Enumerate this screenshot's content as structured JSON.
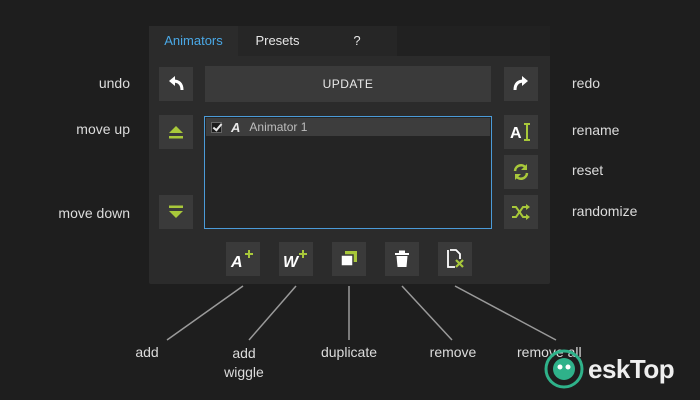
{
  "tabs": [
    {
      "label": "Animators"
    },
    {
      "label": "Presets"
    },
    {
      "label": "?"
    }
  ],
  "toolbar": {
    "update_label": "UPDATE"
  },
  "list": {
    "items": [
      {
        "checked": true,
        "icon": "A",
        "name": "Animator 1"
      }
    ]
  },
  "bottom_buttons": {
    "add_icon": "A",
    "wiggle_icon": "W"
  },
  "labels": {
    "undo": "undo",
    "move_up": "move up",
    "move_down": "move down",
    "redo": "redo",
    "rename": "rename",
    "reset": "reset",
    "randomize": "randomize",
    "add": "add",
    "add_wiggle_1": "add",
    "add_wiggle_2": "wiggle",
    "duplicate": "duplicate",
    "remove": "remove",
    "remove_all": "remove all"
  },
  "watermark": {
    "text": "eskTop"
  },
  "colors": {
    "accent_blue": "#4aa8e6",
    "icon_green": "#a8c83a",
    "panel_bg": "#2b2b2b",
    "page_bg": "#1e1e1e"
  }
}
